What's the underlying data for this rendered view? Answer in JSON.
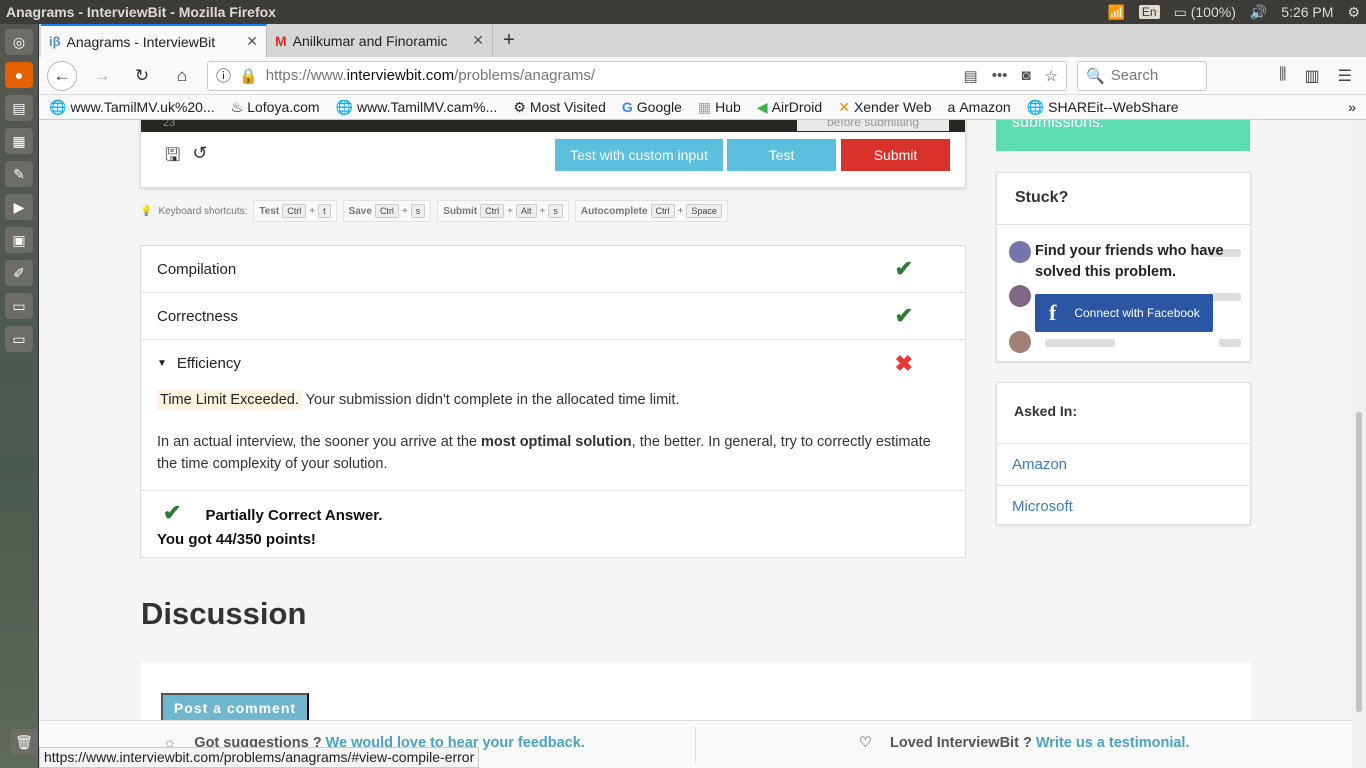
{
  "os": {
    "window_title": "Anagrams - InterviewBit - Mozilla Firefox",
    "lang": "En",
    "battery": "(100%)",
    "time": "5:26 PM"
  },
  "tabs": [
    {
      "icon": "iβ",
      "title": "Anagrams - InterviewBit"
    },
    {
      "icon": "M",
      "title": "Anilkumar and Finoramic"
    }
  ],
  "url": {
    "prefix": "https://www.",
    "domain": "interviewbit.com",
    "path": "/problems/anagrams/"
  },
  "search_placeholder": "Search",
  "bookmarks": [
    "www.TamilMV.uk%20...",
    "Lofoya.com",
    "www.TamilMV.cam%...",
    "Most Visited",
    "Google",
    "Hub",
    "AirDroid",
    "Xender Web",
    "Amazon",
    "SHAREit--WebShare"
  ],
  "editor": {
    "line_number": "23",
    "tooltip": "before submitting"
  },
  "buttons": {
    "custom": "Test with custom input",
    "test": "Test",
    "submit": "Submit"
  },
  "shortcuts": {
    "label": "Keyboard shortcuts:",
    "groups": [
      {
        "name": "Test",
        "keys": [
          "Ctrl",
          "t"
        ]
      },
      {
        "name": "Save",
        "keys": [
          "Ctrl",
          "s"
        ]
      },
      {
        "name": "Submit",
        "keys": [
          "Ctrl",
          "Alt",
          "s"
        ]
      },
      {
        "name": "Autocomplete",
        "keys": [
          "Ctrl",
          "Space"
        ]
      }
    ]
  },
  "results": {
    "compilation": "Compilation",
    "correctness": "Correctness",
    "efficiency": "Efficiency",
    "tle": "Time Limit Exceeded.",
    "tle_msg": "Your submission didn't complete in the allocated time limit.",
    "interview_pre": "In an actual interview, the sooner you arrive at the ",
    "interview_bold": "most optimal solution",
    "interview_post": ", the better. In general, try to correctly estimate the time complexity of your solution.",
    "partial": "Partially Correct Answer.",
    "points": "You got 44/350 points!"
  },
  "discussion": {
    "title": "Discussion",
    "post": "Post a comment"
  },
  "sidebar": {
    "top_text": "submissions.",
    "stuck": "Stuck?",
    "find": "Find your friends who have solved this problem.",
    "fb": "Connect with Facebook",
    "asked": "Asked In:",
    "companies": [
      "Amazon",
      "Microsoft"
    ]
  },
  "footer": {
    "q1": "Got suggestions ?",
    "l1": "We would love to hear your feedback.",
    "q2": "Loved InterviewBit ?",
    "l2": "Write us a testimonial."
  },
  "status_url": "https://www.interviewbit.com/problems/anagrams/#view-compile-error"
}
